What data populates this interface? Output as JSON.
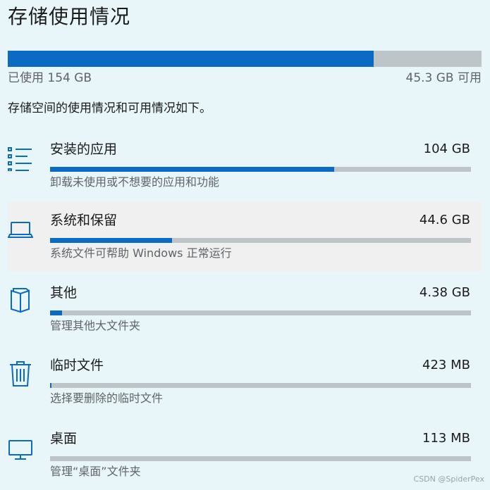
{
  "page": {
    "title": "存储使用情况",
    "used_label": "已使用 154 GB",
    "free_label": "45.3 GB 可用",
    "used_fraction": 0.773,
    "description": "存储空间的使用情况和可用情况如下。"
  },
  "colors": {
    "accent": "#0a6ac4",
    "track": "#bec5c8",
    "background": "#e9f6f9",
    "highlight": "#f0f0f1"
  },
  "categories": [
    {
      "name": "安装的应用",
      "size": "104 GB",
      "subtitle": "卸载未使用或不想要的应用和功能",
      "fraction": 0.675,
      "icon": "list-icon"
    },
    {
      "name": "系统和保留",
      "size": "44.6 GB",
      "subtitle": "系统文件可帮助 Windows 正常运行",
      "fraction": 0.29,
      "icon": "laptop-icon"
    },
    {
      "name": "其他",
      "size": "4.38 GB",
      "subtitle": "管理其他大文件夹",
      "fraction": 0.028,
      "icon": "folder-icon"
    },
    {
      "name": "临时文件",
      "size": "423 MB",
      "subtitle": "选择要删除的临时文件",
      "fraction": 0.003,
      "icon": "trash-icon"
    },
    {
      "name": "桌面",
      "size": "113 MB",
      "subtitle": "管理“桌面”文件夹",
      "fraction": 0.0,
      "icon": "monitor-icon"
    }
  ],
  "watermark": "CSDN @SpiderPex"
}
